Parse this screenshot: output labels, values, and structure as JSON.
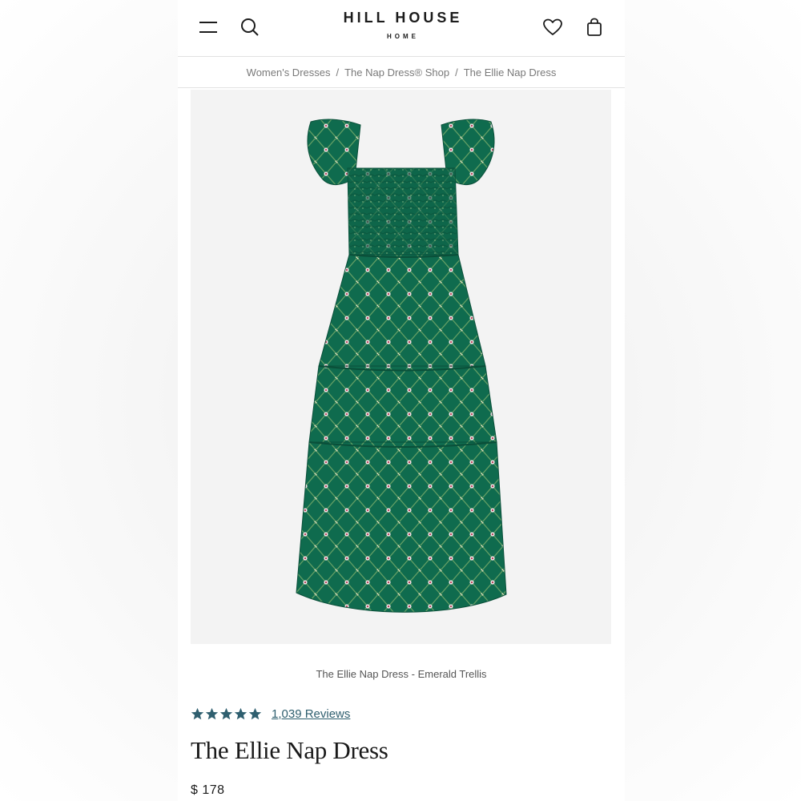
{
  "header": {
    "brand_main": "HILL HOUSE",
    "brand_sub": "HOME",
    "icons": [
      "menu-icon",
      "search-icon",
      "heart-icon",
      "shopping-bag-icon"
    ]
  },
  "breadcrumb": {
    "items": [
      "Women's Dresses",
      "The Nap Dress® Shop",
      "The Ellie Nap Dress"
    ],
    "separator": "/"
  },
  "product": {
    "caption": "The Ellie Nap Dress - Emerald Trellis",
    "rating_stars": 5,
    "reviews_label": "1,039 Reviews",
    "title": "The Ellie Nap Dress",
    "price": "$ 178"
  },
  "colors": {
    "dress_green": "#0f6b4e",
    "star_color": "#2f5f6f",
    "image_bg": "#f3f3f3"
  }
}
